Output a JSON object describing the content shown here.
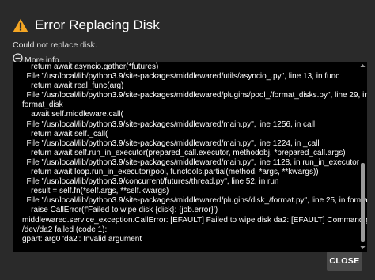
{
  "dialog": {
    "title": "Error Replacing Disk",
    "subtitle": "Could not replace disk.",
    "more_info_label": "More info...",
    "traceback_lines": [
      "    return await asyncio.gather(*futures)",
      "  File \"/usr/local/lib/python3.9/site-packages/middlewared/utils/asyncio_.py\", line 13, in func",
      "    return await real_func(arg)",
      "  File \"/usr/local/lib/python3.9/site-packages/middlewared/plugins/pool_/format_disks.py\", line 29, in",
      "format_disk",
      "    await self.middleware.call(",
      "  File \"/usr/local/lib/python3.9/site-packages/middlewared/main.py\", line 1256, in call",
      "    return await self._call(",
      "  File \"/usr/local/lib/python3.9/site-packages/middlewared/main.py\", line 1224, in _call",
      "    return await self.run_in_executor(prepared_call.executor, methodobj, *prepared_call.args)",
      "  File \"/usr/local/lib/python3.9/site-packages/middlewared/main.py\", line 1128, in run_in_executor",
      "    return await loop.run_in_executor(pool, functools.partial(method, *args, **kwargs))",
      "  File \"/usr/local/lib/python3.9/concurrent/futures/thread.py\", line 52, in run",
      "    result = self.fn(*self.args, **self.kwargs)",
      "  File \"/usr/local/lib/python3.9/site-packages/middlewared/plugins/disk_/format.py\", line 25, in format",
      "    raise CallError(f'Failed to wipe disk {disk}: {job.error}')",
      "middlewared.service_exception.CallError: [EFAULT] Failed to wipe disk da2: [EFAULT] Command gpart destroy -F",
      "/dev/da2 failed (code 1):",
      "gpart: arg0 'da2': Invalid argument"
    ],
    "close_label": "CLOSE"
  },
  "colors": {
    "background": "#2a2a2a",
    "warning_icon": "#f5a623",
    "trace_background": "#000000",
    "button_background": "#4a4a4a"
  },
  "icons": {
    "title": "warning-icon",
    "more_info": "minus-circle-icon"
  }
}
